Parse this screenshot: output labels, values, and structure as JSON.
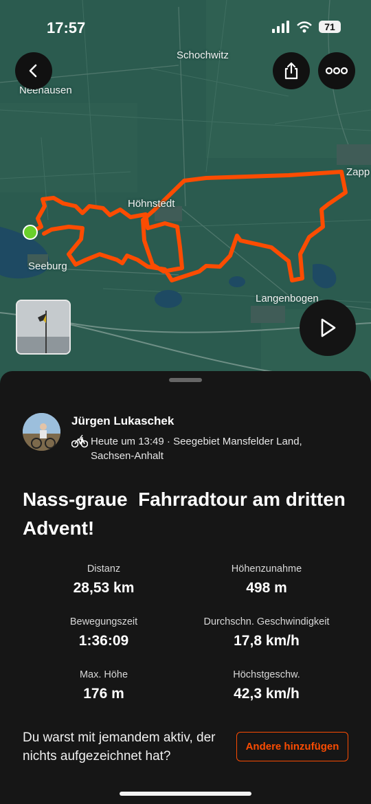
{
  "status_bar": {
    "time": "17:57",
    "battery": "71"
  },
  "map": {
    "towns": {
      "schochwitz": "Schochwitz",
      "neehausen": "Neehausen",
      "zappendorf": "Zapp",
      "hoehnstedt": "Höhnstedt",
      "seeburg": "Seeburg",
      "langenbogen": "Langenbogen"
    },
    "route_color": "#fc4c02",
    "start_color": "#6ad02b",
    "icons": [
      "back-icon",
      "share-icon",
      "more-icon",
      "play-icon"
    ]
  },
  "activity": {
    "athlete_name": "Jürgen Lukaschek",
    "meta": "Heute um 13:49 · Seegebiet Mansfelder Land, Sachsen-Anhalt",
    "title": "Nass-graue  Fahrradtour am dritten Advent!",
    "stats": [
      {
        "label": "Distanz",
        "value": "28,53 km"
      },
      {
        "label": "Höhenzunahme",
        "value": "498 m"
      },
      {
        "label": "Bewegungszeit",
        "value": "1:36:09"
      },
      {
        "label": "Durchschn. Geschwindigkeit",
        "value": "17,8 km/h"
      },
      {
        "label": "Max. Höhe",
        "value": "176 m"
      },
      {
        "label": "Höchstgeschw.",
        "value": "42,3 km/h"
      }
    ],
    "prompt": "Du warst mit jemandem aktiv, der nichts aufgezeichnet hat?",
    "add_button": "Andere hinzufügen"
  }
}
